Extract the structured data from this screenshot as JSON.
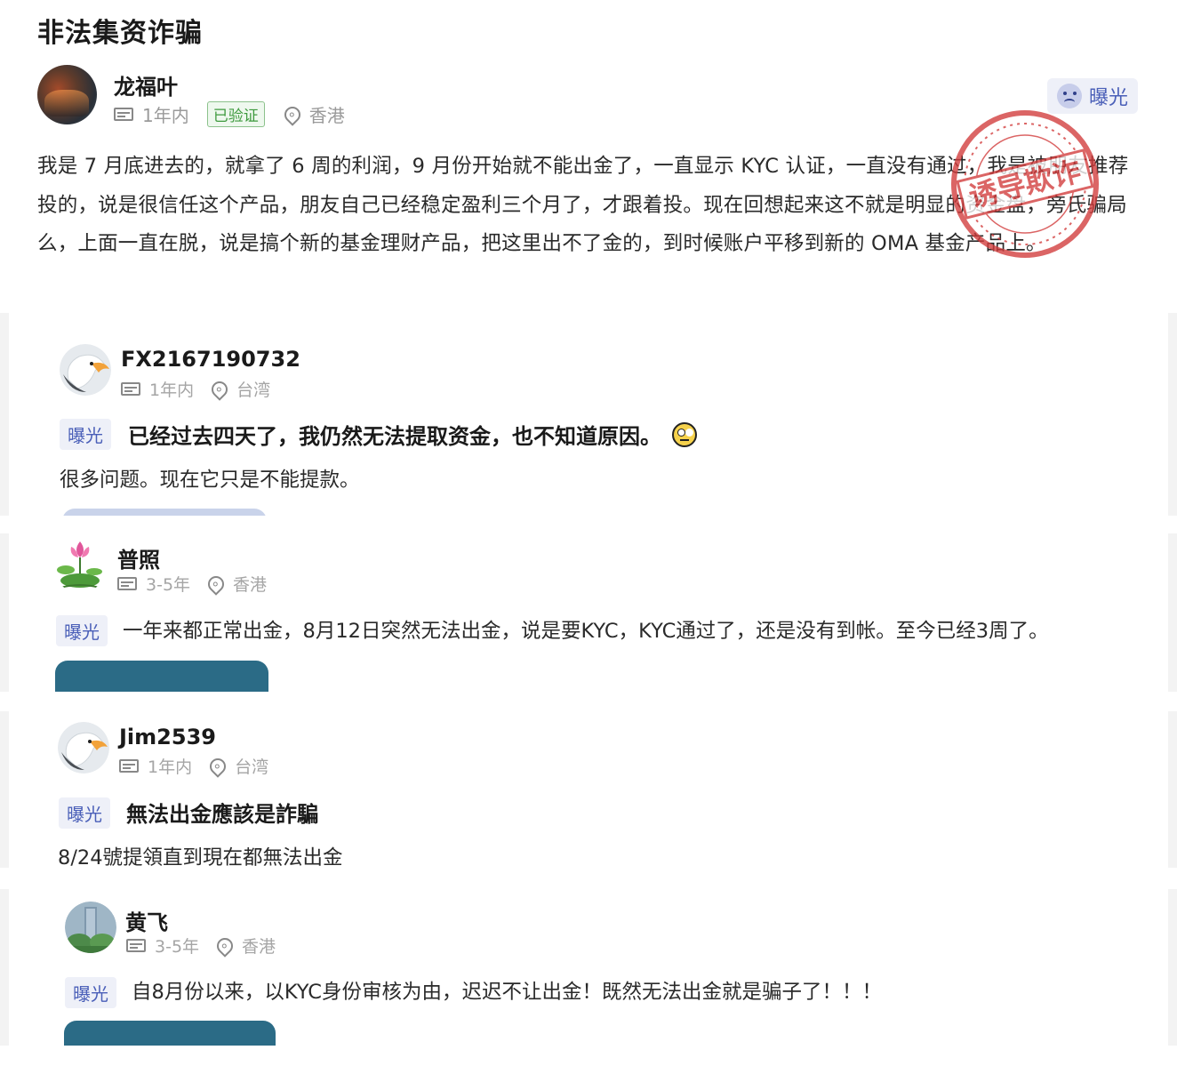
{
  "page_title": "非法集资诈骗",
  "main_post": {
    "user_name": "龙福叶",
    "time": "1年内",
    "verified": "已验证",
    "location": "香港",
    "expose_label": "曝光",
    "stamp_text": "诱导欺诈",
    "text": "我是 7 月底进去的，就拿了 6 周的利润，9 月份开始就不能出金了，一直显示 KYC 认证，一直没有通过，我是被朋友推荐投的，说是很信任这个产品，朋友自己已经稳定盈利三个月了，才跟着投。现在回想起来这不就是明显的资金盘，旁氏骗局么，上面一直在脱，说是搞个新的基金理财产品，把这里出不了金的，到时候账户平移到新的 OMA 基金产品上。"
  },
  "reviews": [
    {
      "user_name": "FX2167190732",
      "time": "1年内",
      "location": "台湾",
      "tag": "曝光",
      "title": "已经过去四天了，我仍然无法提取资金，也不知道原因。",
      "body": "很多问题。现在它只是不能提款。"
    },
    {
      "user_name": "普照",
      "time": "3-5年",
      "location": "香港",
      "tag": "曝光",
      "title": "一年来都正常出金，8月12日突然无法出金，说是要KYC，KYC通过了，还是没有到帐。至今已经3周了。"
    },
    {
      "user_name": "Jim2539",
      "time": "1年内",
      "location": "台湾",
      "tag": "曝光",
      "title": "無法出金應該是詐騙",
      "body": "8/24號提領直到現在都無法出金"
    },
    {
      "user_name": "黄飞",
      "time": "3-5年",
      "location": "香港",
      "tag": "曝光",
      "title": "自8月份以来，以KYC身份审核为由，迟迟不让出金！既然无法出金就是骗子了！！！"
    }
  ],
  "colors": {
    "accent": "#4a5fb8",
    "tag_bg": "#eef0f8",
    "verified": "#3e9a3e",
    "stamp": "#d23a3a"
  }
}
